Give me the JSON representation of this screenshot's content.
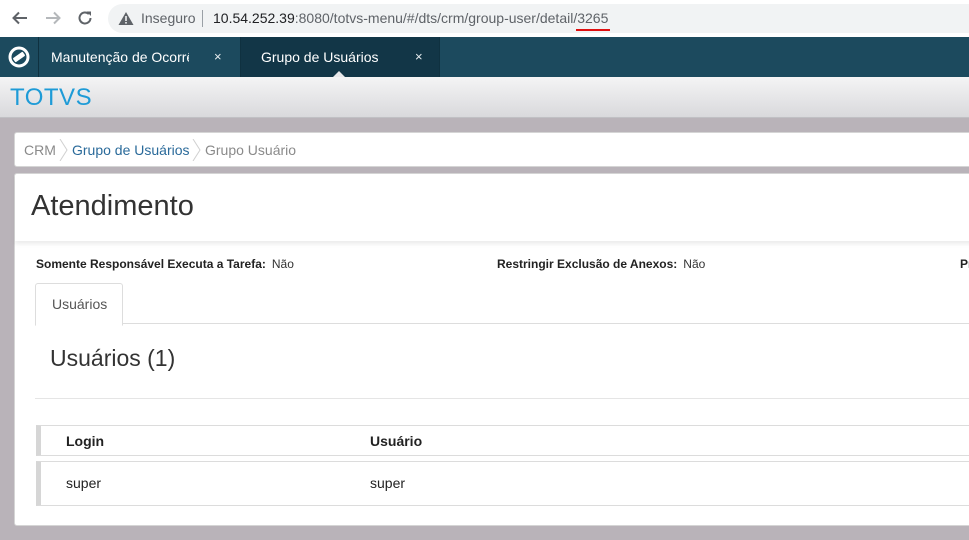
{
  "browser": {
    "security_label": "Inseguro",
    "url_host": "10.54.252.39",
    "url_path_dim": ":8080/totvs-menu/#/dts/crm/group-user/detail/",
    "url_id": "3265"
  },
  "app_tabs": [
    {
      "label": "Manutenção de Ocorrência",
      "close": "×",
      "active": false
    },
    {
      "label": "Grupo de Usuários",
      "close": "×",
      "active": true
    }
  ],
  "brand": "TOTVS",
  "breadcrumb": [
    "CRM",
    "Grupo de Usuários",
    "Grupo Usuário"
  ],
  "page": {
    "title": "Atendimento",
    "fields": [
      {
        "label": "Somente Responsável Executa a Tarefa:",
        "value": "Não"
      },
      {
        "label": "Restringir Exclusão de Anexos:",
        "value": "Não"
      },
      {
        "label": "Pr",
        "value": ""
      }
    ],
    "tabs": [
      {
        "label": "Usuários"
      }
    ],
    "section_title": "Usuários (1)",
    "table": {
      "columns": [
        "Login",
        "Usuário"
      ],
      "rows": [
        [
          "super",
          "super"
        ]
      ]
    }
  },
  "colors": {
    "tab_bar": "#1c4a5e",
    "active_tab": "#123647",
    "brand": "#1e9bd7",
    "link": "#2a6a9a",
    "content_bg": "#b9b3b9"
  }
}
